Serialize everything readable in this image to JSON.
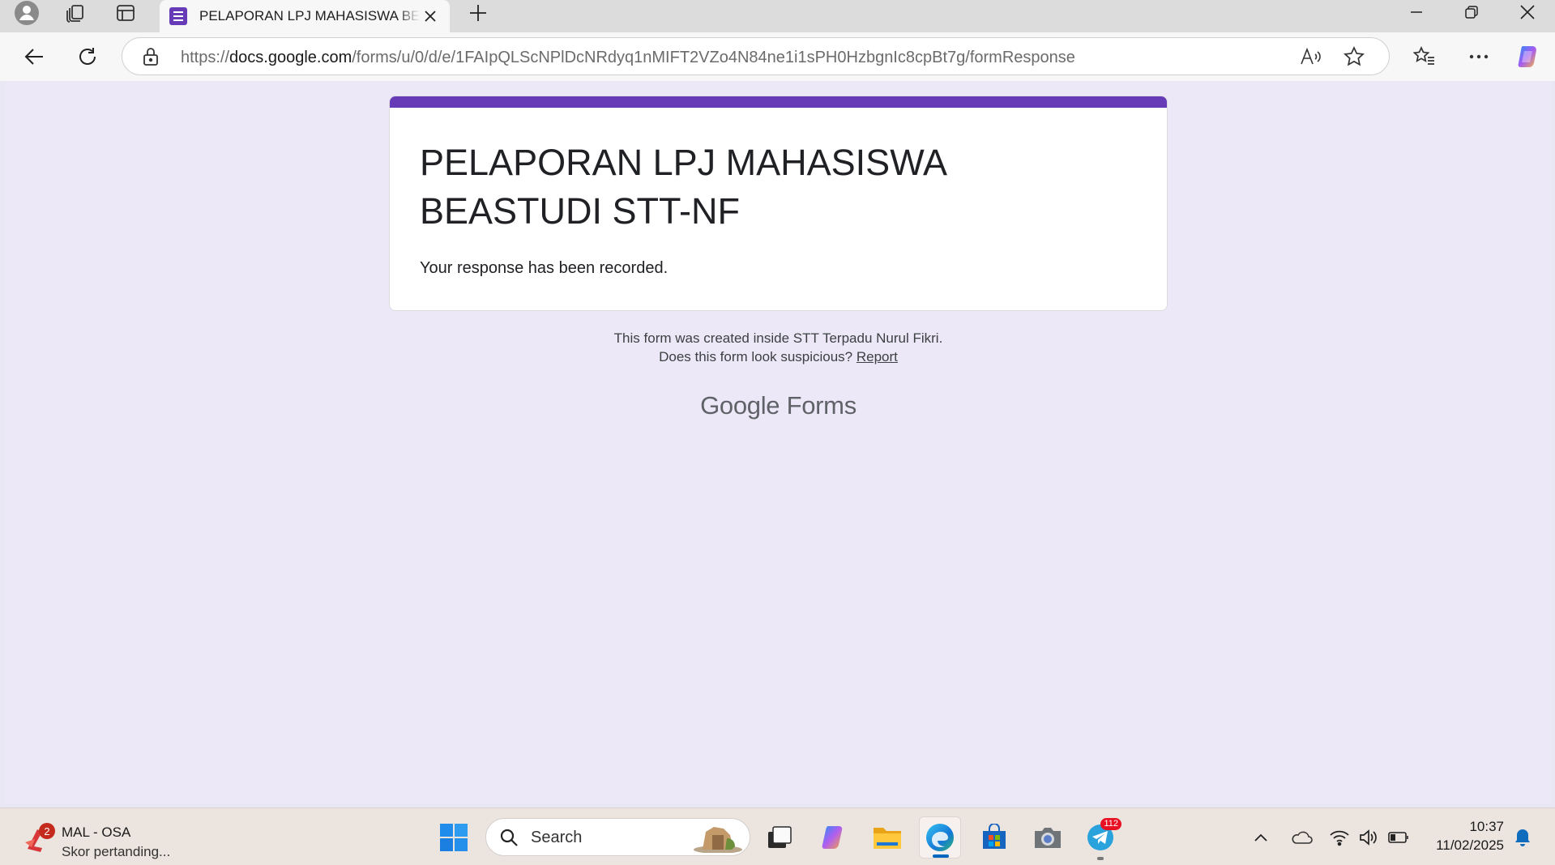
{
  "browser": {
    "tab": {
      "title": "PELAPORAN LPJ MAHASISWA BEASTUDI STT-NF"
    },
    "url": {
      "prefix": "https://",
      "host": "docs.google.com",
      "path": "/forms/u/0/d/e/1FAIpQLScNPlDcNRdyq1nMIFT2VZo4N84ne1i1sPH0HzbgnIc8cpBt7g/formResponse"
    }
  },
  "form": {
    "title": "PELAPORAN LPJ MAHASISWA BEASTUDI STT-NF",
    "message": "Your response has been recorded.",
    "accent_color": "#673ab7",
    "footer_line1": "This form was created inside STT Terpadu Nurul Fikri.",
    "footer_line2_prefix": "Does this form look suspicious? ",
    "report_link": "Report",
    "brand_google": "Google",
    "brand_forms": "Forms"
  },
  "taskbar": {
    "widget": {
      "title": "MAL - OSA",
      "subtitle": "Skor pertanding...",
      "badge": "2"
    },
    "search_placeholder": "Search",
    "telegram_badge": "112",
    "clock_time": "10:37",
    "clock_date": "11/02/2025"
  },
  "icons": [
    "profile-icon",
    "workspaces-icon",
    "tab-actions-icon",
    "forms-favicon",
    "close-icon",
    "plus-icon",
    "minimize-icon",
    "restore-icon",
    "window-close-icon",
    "back-icon",
    "refresh-icon",
    "lock-icon",
    "read-aloud-icon",
    "star-icon",
    "favorites-icon",
    "more-icon",
    "copilot-icon",
    "windows-start-icon",
    "search-icon",
    "task-view-icon",
    "copilot-app-icon",
    "file-explorer-icon",
    "edge-icon",
    "store-icon",
    "camera-icon",
    "telegram-icon",
    "chevron-up-icon",
    "onedrive-icon",
    "wifi-icon",
    "volume-icon",
    "battery-icon",
    "notification-bell-icon"
  ]
}
